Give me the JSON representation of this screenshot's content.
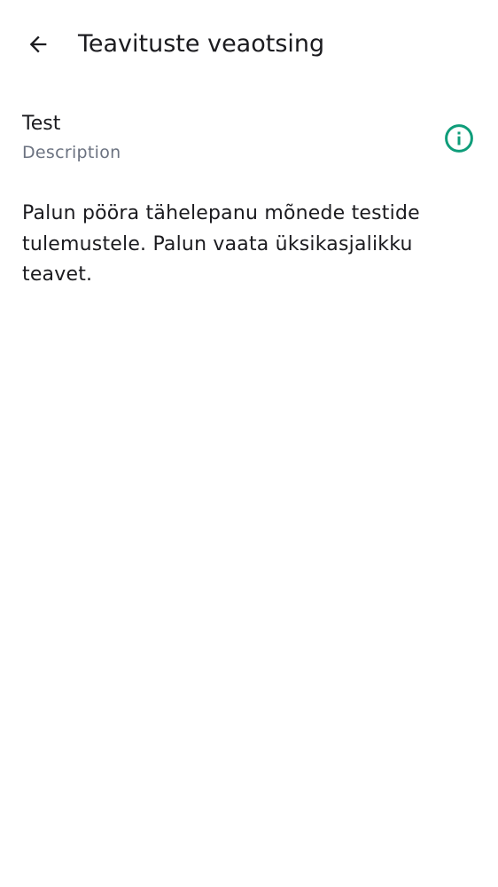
{
  "header": {
    "back_icon": "arrow-back-icon",
    "title": "Teavituste veaotsing"
  },
  "test_item": {
    "title": "Test",
    "description": "Description",
    "info_icon": "info-circle-icon",
    "accent_color": "#0f9d7a"
  },
  "message": {
    "text": "Palun pööra tähelepanu mõnede testide tulemustele. Palun vaata üksikasjalikku teavet."
  }
}
